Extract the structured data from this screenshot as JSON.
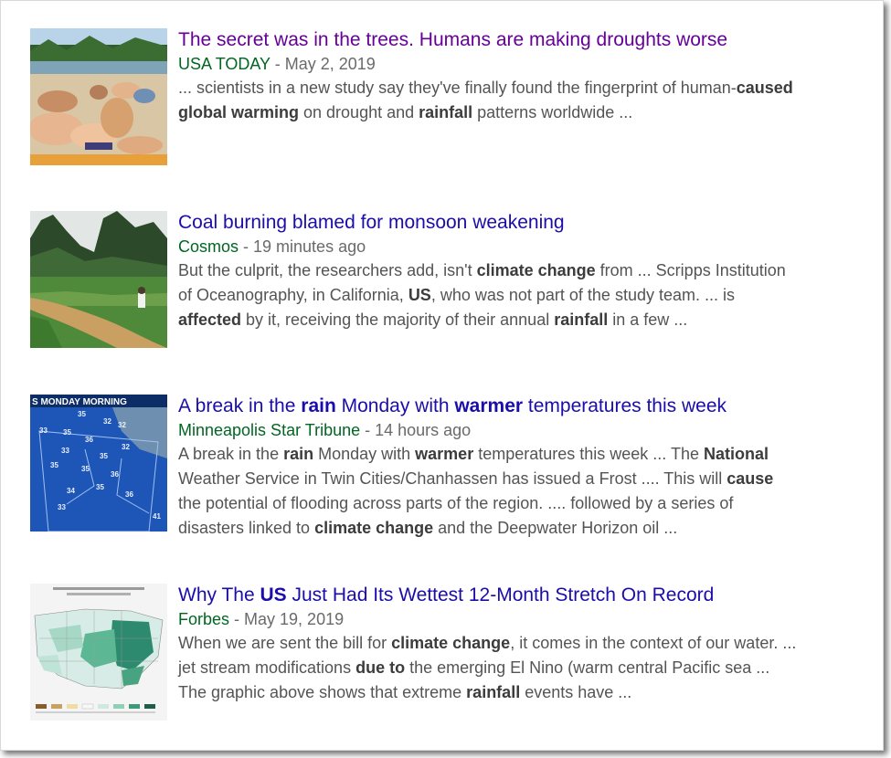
{
  "results": [
    {
      "visited": true,
      "title": [
        {
          "t": "The secret was in the trees. Humans are making droughts worse"
        }
      ],
      "source": "USA TODAY",
      "date": "May 2, 2019",
      "snippet": [
        [
          {
            "t": "... scientists in a new study say they've finally found the fingerprint of human-"
          },
          {
            "t": "caused",
            "b": true
          }
        ],
        [
          {
            "t": "global warming",
            "b": true
          },
          {
            "t": " on drought and "
          },
          {
            "t": "rainfall",
            "b": true
          },
          {
            "t": " patterns worldwide ..."
          }
        ]
      ]
    },
    {
      "visited": false,
      "title": [
        {
          "t": "Coal burning blamed for monsoon weakening"
        }
      ],
      "source": "Cosmos",
      "date": "19 minutes ago",
      "snippet": [
        [
          {
            "t": "But the culprit, the researchers add, isn't "
          },
          {
            "t": "climate change",
            "b": true
          },
          {
            "t": " from ... Scripps Institution"
          }
        ],
        [
          {
            "t": "of Oceanography, in California, "
          },
          {
            "t": "US",
            "b": true
          },
          {
            "t": ", who was not part of the study team. ... is"
          }
        ],
        [
          {
            "t": "affected",
            "b": true
          },
          {
            "t": " by it, receiving the majority of their annual "
          },
          {
            "t": "rainfall",
            "b": true
          },
          {
            "t": " in a few ..."
          }
        ]
      ]
    },
    {
      "visited": false,
      "title": [
        {
          "t": "A break in the "
        },
        {
          "t": "rain",
          "b": true
        },
        {
          "t": " Monday with "
        },
        {
          "t": "warmer",
          "b": true
        },
        {
          "t": " temperatures this week"
        }
      ],
      "source": "Minneapolis Star Tribune",
      "date": "14 hours ago",
      "snippet": [
        [
          {
            "t": "A break in the "
          },
          {
            "t": "rain",
            "b": true
          },
          {
            "t": " Monday with "
          },
          {
            "t": "warmer",
            "b": true
          },
          {
            "t": " temperatures this week ... The "
          },
          {
            "t": "National",
            "b": true
          }
        ],
        [
          {
            "t": "Weather Service in Twin Cities/Chanhassen has issued a Frost .... This will "
          },
          {
            "t": "cause",
            "b": true
          }
        ],
        [
          {
            "t": "the potential of flooding across parts of the region. .... followed by a series of"
          }
        ],
        [
          {
            "t": "disasters linked to "
          },
          {
            "t": "climate change",
            "b": true
          },
          {
            "t": " and the Deepwater Horizon oil ..."
          }
        ]
      ],
      "thumb_text": {
        "header": "S MONDAY MORNING",
        "temps": [
          "35",
          "33",
          "32",
          "32",
          "35",
          "36",
          "33",
          "35",
          "32",
          "35",
          "35",
          "36",
          "34",
          "35",
          "36",
          "33",
          "41"
        ]
      }
    },
    {
      "visited": false,
      "title": [
        {
          "t": "Why The "
        },
        {
          "t": "US",
          "b": true
        },
        {
          "t": " Just Had Its Wettest 12-Month Stretch On Record"
        }
      ],
      "source": "Forbes",
      "date": "May 19, 2019",
      "snippet": [
        [
          {
            "t": "When we are sent the bill for "
          },
          {
            "t": "climate change",
            "b": true
          },
          {
            "t": ", it comes in the context of our water. ..."
          }
        ],
        [
          {
            "t": "jet stream modifications "
          },
          {
            "t": "due to",
            "b": true
          },
          {
            "t": " the emerging El Nino (warm central Pacific sea ..."
          }
        ],
        [
          {
            "t": "The graphic above shows that extreme "
          },
          {
            "t": "rainfall",
            "b": true
          },
          {
            "t": " events have ..."
          }
        ]
      ]
    }
  ],
  "separator": " - ",
  "colors": {
    "link": "#1a0dab",
    "visited": "#660099",
    "source": "#006621",
    "snippet": "#545454"
  }
}
